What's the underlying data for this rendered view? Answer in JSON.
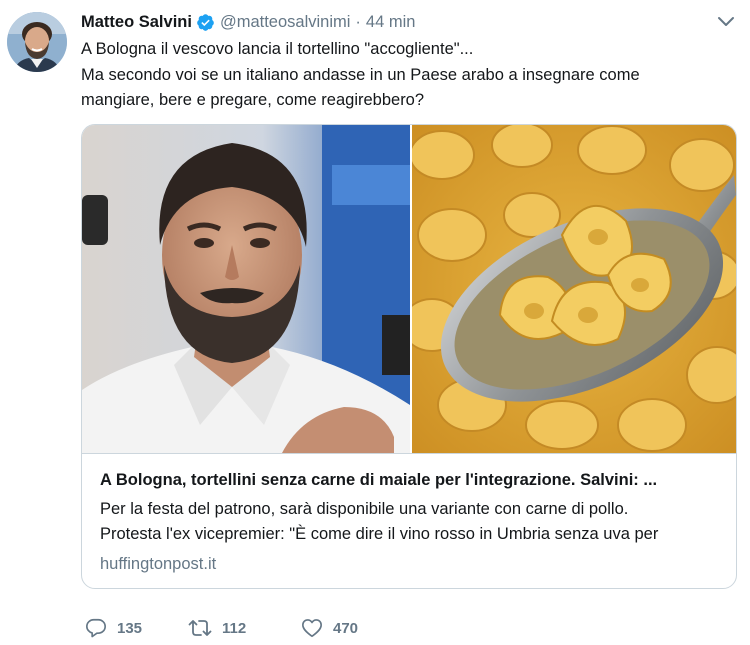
{
  "tweet": {
    "author_name": "Matteo Salvini",
    "handle": "@matteosalvinimi",
    "separator": "·",
    "time": "44 min",
    "text_lines": [
      "A Bologna il vescovo lancia il tortellino \"accogliente\"...",
      "Ma secondo voi se un italiano andasse in un Paese arabo a insegnare come",
      "mangiare, bere e pregare, come reagirebbero?"
    ]
  },
  "card": {
    "title": "A Bologna, tortellini senza carne di maiale per l'integrazione. Salvini: ...",
    "description_lines": [
      "Per la festa del patrono, sarà disponibile una variante con carne di pollo.",
      "Protesta l'ex vicepremier: \"È come dire il vino rosso in Umbria senza uva per"
    ],
    "domain": "huffingtonpost.it",
    "images": [
      "portrait-photo",
      "tortellini-spoon-photo"
    ]
  },
  "actions": {
    "replies": "135",
    "retweets": "112",
    "likes": "470"
  },
  "icons": {
    "verified": "verified-badge-icon",
    "caret": "chevron-down-icon",
    "reply": "reply-icon",
    "retweet": "retweet-icon",
    "like": "heart-icon"
  },
  "colors": {
    "verified": "#1da1f2",
    "text": "#14171a",
    "secondary": "#657786",
    "border": "#ccd6dd"
  }
}
